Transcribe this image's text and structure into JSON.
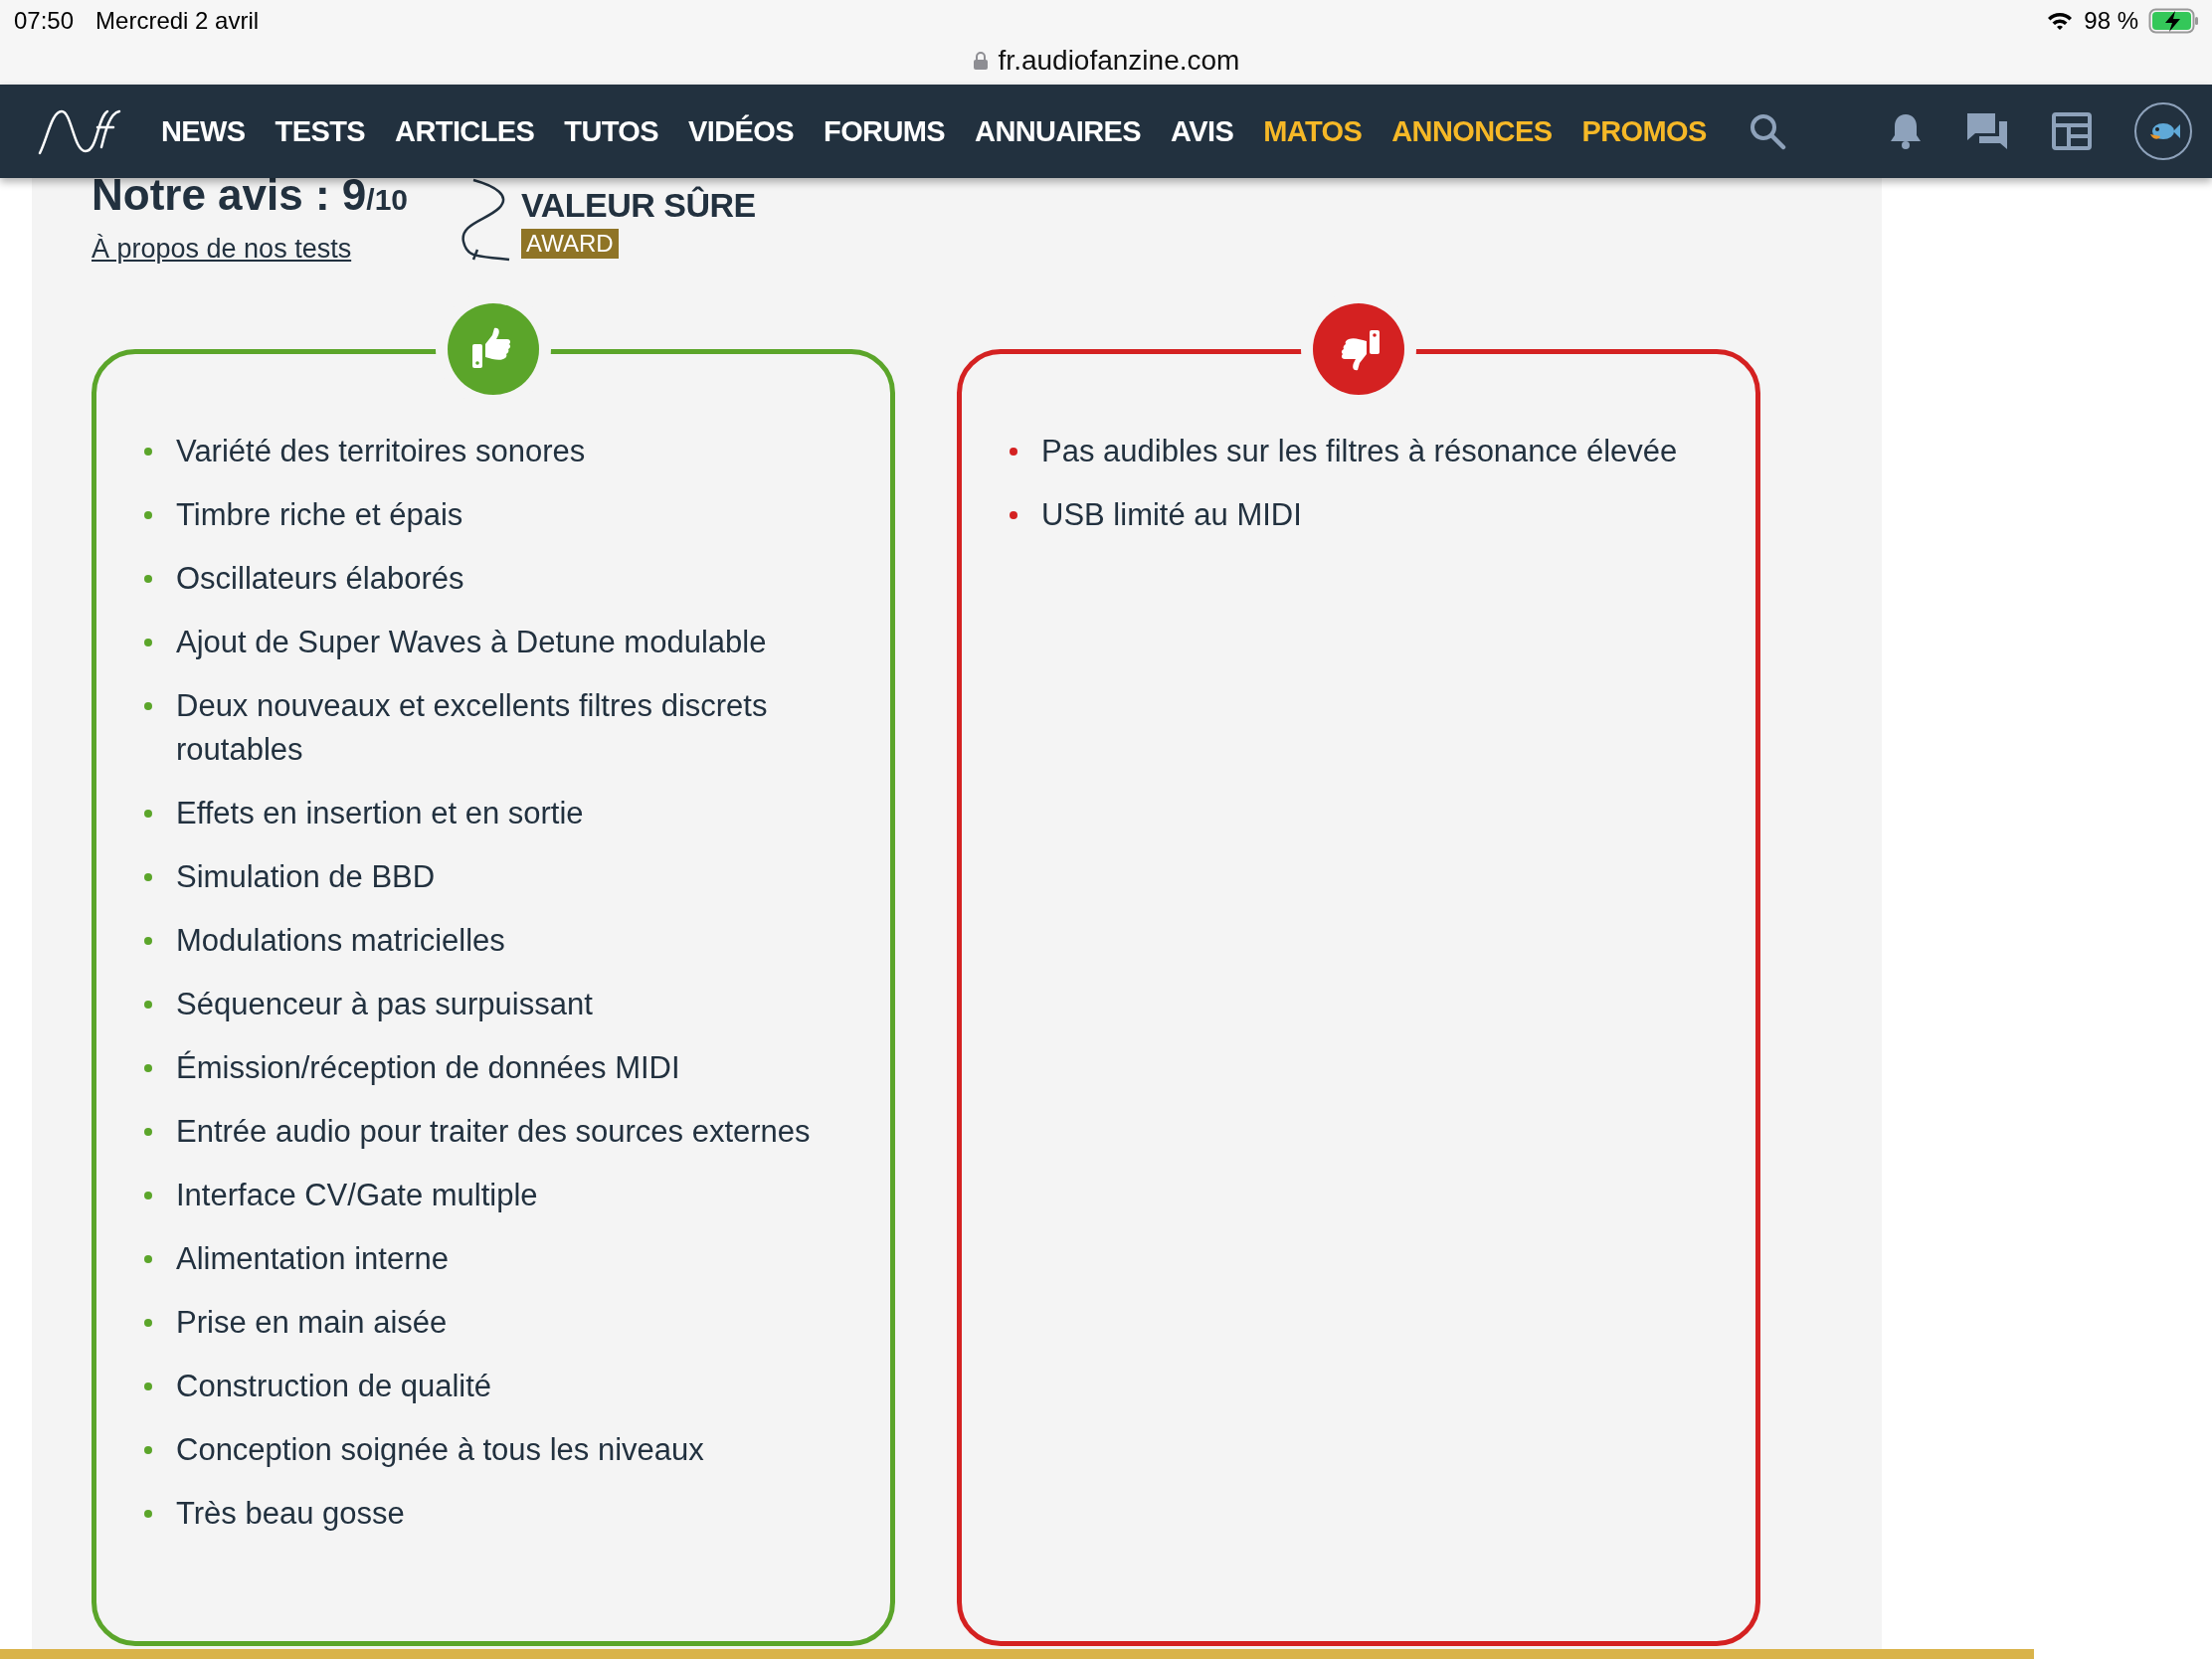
{
  "status_bar": {
    "time": "07:50",
    "date": "Mercredi 2 avril",
    "battery": "98 %"
  },
  "address_bar": {
    "url": "fr.audiofanzine.com"
  },
  "nav": {
    "items": [
      {
        "label": "NEWS",
        "featured": false
      },
      {
        "label": "TESTS",
        "featured": false
      },
      {
        "label": "ARTICLES",
        "featured": false
      },
      {
        "label": "TUTOS",
        "featured": false
      },
      {
        "label": "VIDÉOS",
        "featured": false
      },
      {
        "label": "FORUMS",
        "featured": false
      },
      {
        "label": "ANNUAIRES",
        "featured": false
      },
      {
        "label": "AVIS",
        "featured": false
      },
      {
        "label": "MATOS",
        "featured": true
      },
      {
        "label": "ANNONCES",
        "featured": true
      },
      {
        "label": "PROMOS",
        "featured": true
      }
    ]
  },
  "review": {
    "title": "Notre avis : ",
    "score": "9",
    "scale": "/10",
    "link": "À propos de nos tests",
    "award": {
      "name": "VALEUR SÛRE",
      "tag": "AWARD"
    }
  },
  "cards": [
    {
      "kind": "pros",
      "items": [
        "Variété des territoires sonores",
        "Timbre riche et épais",
        "Oscillateurs élaborés",
        "Ajout de Super Waves à Detune modulable",
        "Deux nouveaux et excellents filtres discrets routables",
        "Effets en insertion et en sortie",
        "Simulation de BBD",
        "Modulations matricielles",
        "Séquenceur à pas surpuissant",
        "Émission/réception de données MIDI",
        "Entrée audio pour traiter des sources externes",
        "Interface CV/Gate multiple",
        "Alimentation interne",
        "Prise en main aisée",
        "Construction de qualité",
        "Conception soignée à tous les niveaux",
        "Très beau gosse"
      ]
    },
    {
      "kind": "cons",
      "items": [
        "Pas audibles sur les filtres à résonance élevée",
        "USB limité au MIDI"
      ]
    }
  ]
}
